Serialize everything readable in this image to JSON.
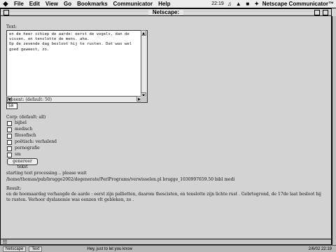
{
  "menubar": {
    "apple_icon": "apple-icon",
    "items": [
      "File",
      "Edit",
      "View",
      "Go",
      "Bookmarks",
      "Communicator",
      "Help"
    ],
    "clock": "22:19",
    "app_name": "Netscape Communicator™"
  },
  "window": {
    "title": "Netscape:"
  },
  "form": {
    "text_label": "Text:",
    "text_value": "en de heer schiep de aarde: eerst de vogels, dan de vissen, en tenslotte de mens. aha.\nOp de zevende dag besloot hij te rusten. Dat was wel goed geweest, zo.",
    "prosent_label": "Prosent: (default: 50)",
    "prosent_value": "50",
    "corp_label": "Corp: (default: all)",
    "corp_options": [
      "bijbel",
      "medisch",
      "filosofisch",
      "poëtisch: verhalend",
      "pornografie",
      "sm"
    ],
    "submit_label": "genereer tekst"
  },
  "output": {
    "processing_line1": "starting text processing... please wait",
    "processing_line2": "/home/thomas/pub/brugge2002/degenerate/PerlPrograms/verwisselen.pl brugge_1030997659.50 bibl medi",
    "result_label": "Result:",
    "result_text": "en de hoomaardag verhangde de aarde : eerst zijn pallietten, daarom thescisten, en tenslotte zijn lichte rust . Gebrtegrond, de 17de laat besloot hij te rusten. Verhoor dyslaxemie was eenzen vlt gebleken, zo ."
  },
  "statusbar": {
    "icon": "lock-icon"
  },
  "taskbar": {
    "items": [
      "Netscape",
      "Text"
    ],
    "message": "Hey, just to let you know",
    "clock": "2/6/02 22:19"
  }
}
